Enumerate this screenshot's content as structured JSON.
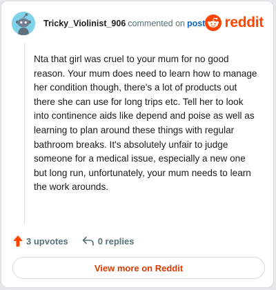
{
  "header": {
    "username": "Tricky_Violinist_906",
    "commented_on": "commented on",
    "post_link": "post",
    "brand": "reddit"
  },
  "comment": {
    "body": "Nta that girl was cruel to your mum for no good reason. Your mum does need to learn how to manage her condition though, there's a lot of products out there she can use for long trips etc. Tell her to look into continence aids like depend and poise as well as learning to plan around these things with regular bathroom breaks. It's absolutely unfair to judge someone for a medical issue, especially a new one but long run, unfortunately, your mum needs to learn the work arounds."
  },
  "actions": {
    "upvotes": "3 upvotes",
    "replies": "0 replies"
  },
  "footer": {
    "view_more": "View more on Reddit"
  },
  "colors": {
    "brand": "#ff4500",
    "link": "#0a66c2",
    "view_more": "#d93a00",
    "avatar_bg": "#7fd3e8"
  },
  "icons": {
    "avatar": "snoo-avatar-icon",
    "logo": "reddit-logo-icon",
    "upvote": "upvote-arrow-icon",
    "reply": "reply-arrow-icon"
  }
}
